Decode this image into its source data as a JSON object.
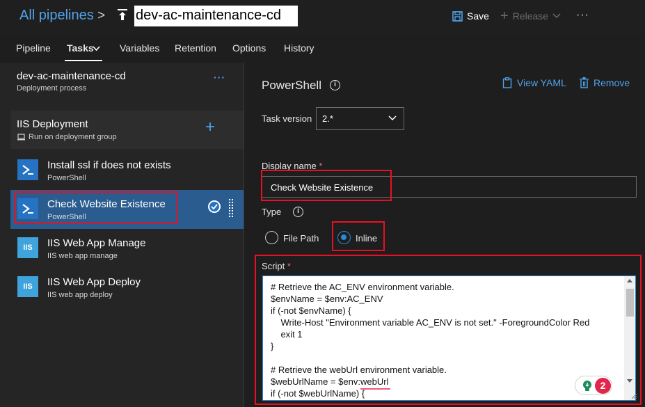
{
  "header": {
    "breadcrumb_root": "All pipelines",
    "breadcrumb_separator": ">",
    "pipeline_name": "dev-ac-maintenance-cd",
    "save_label": "Save",
    "release_label": "Release",
    "more_label": "···"
  },
  "tabs": [
    {
      "label": "Pipeline"
    },
    {
      "label": "Tasks"
    },
    {
      "label": "Variables"
    },
    {
      "label": "Retention"
    },
    {
      "label": "Options"
    },
    {
      "label": "History"
    }
  ],
  "left_panel": {
    "process_title": "dev-ac-maintenance-cd",
    "process_subtitle": "Deployment process",
    "more_label": "···",
    "job": {
      "title": "IIS Deployment",
      "subtitle": "Run on deployment group",
      "add_label": "+"
    },
    "tasks": [
      {
        "title": "Install ssl if does not exists",
        "subtitle": "PowerShell",
        "icon": "powershell-icon"
      },
      {
        "title": "Check Website Existence",
        "subtitle": "PowerShell",
        "icon": "powershell-icon"
      },
      {
        "title": "IIS Web App Manage",
        "subtitle": "IIS web app manage",
        "icon": "iis-icon",
        "icon_text": "IIS"
      },
      {
        "title": "IIS Web App Deploy",
        "subtitle": "IIS web app deploy",
        "icon": "iis-icon",
        "icon_text": "IIS"
      }
    ]
  },
  "right_panel": {
    "task_title": "PowerShell",
    "view_yaml_label": "View YAML",
    "remove_label": "Remove",
    "task_version_label": "Task version",
    "task_version_value": "2.*",
    "display_name_label": "Display name",
    "display_name_value": "Check Website Existence",
    "required_marker": "*",
    "type_label": "Type",
    "type_options": {
      "file_path": "File Path",
      "inline": "Inline",
      "selected": "Inline"
    },
    "script_label": "Script",
    "script_lines": [
      "# Retrieve the AC_ENV environment variable.",
      "$envName = $env:AC_ENV",
      "if (-not $envName) {",
      "    Write-Host \"Environment variable AC_ENV is not set.\" -ForegroundColor Red",
      "    exit 1",
      "}",
      "",
      "# Retrieve the webUrl environment variable.",
      "$webUrlName = $env:webUrl",
      "if (-not $webUrlName) {"
    ]
  },
  "badge": {
    "count": "2"
  },
  "colors": {
    "accent": "#4fa3ea",
    "selected_row": "#2b5c8f",
    "highlight_box": "#e81123",
    "powershell": "#2673c4",
    "iis": "#3fa3dc"
  }
}
